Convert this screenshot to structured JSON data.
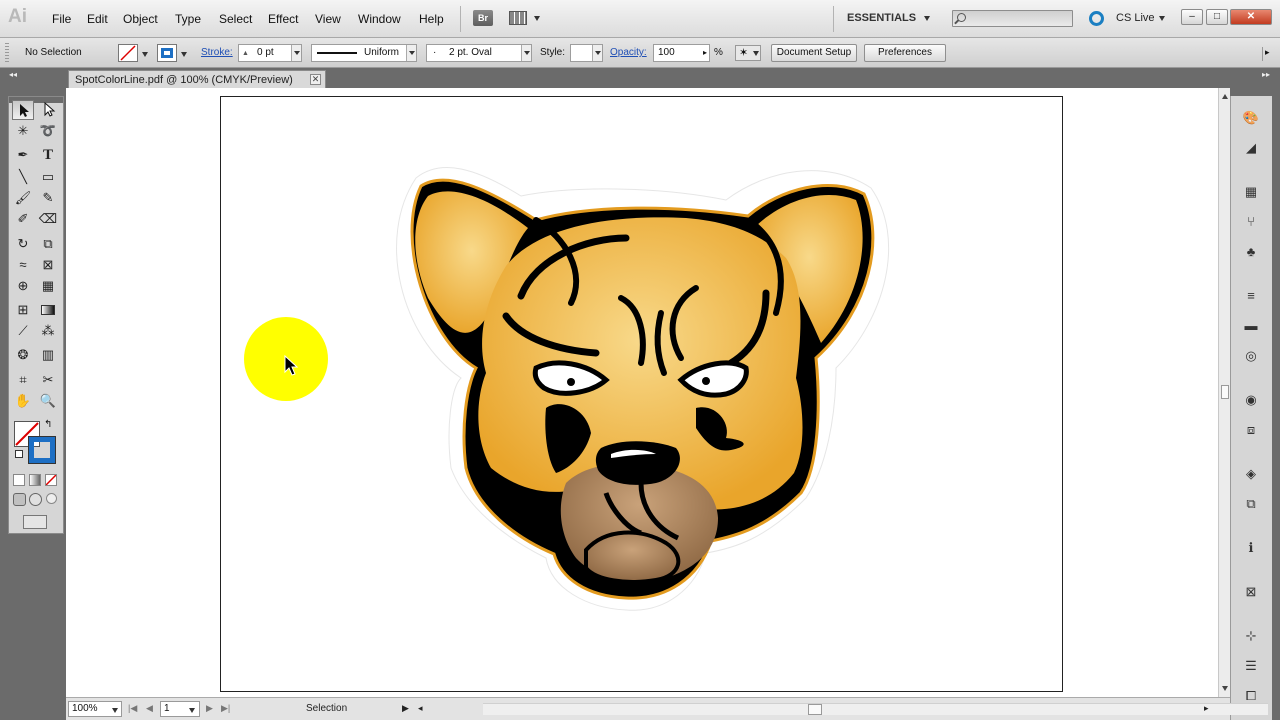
{
  "app": {
    "logo": "Ai",
    "bridge_label": "Br"
  },
  "menu": [
    "File",
    "Edit",
    "Object",
    "Type",
    "Select",
    "Effect",
    "View",
    "Window",
    "Help"
  ],
  "workspace": "ESSENTIALS",
  "search_placeholder": "",
  "cs_live": "CS Live",
  "window_controls": {
    "minimize": "–",
    "maximize": "□",
    "close": "✕"
  },
  "control_bar": {
    "selection": "No Selection",
    "stroke_label": "Stroke:",
    "stroke_weight": "0 pt",
    "profile": "Uniform",
    "brush": "2 pt. Oval",
    "brush_dot": "·",
    "style_label": "Style:",
    "opacity_label": "Opacity:",
    "opacity_value": "100",
    "opacity_unit": "%",
    "document_setup": "Document Setup",
    "preferences": "Preferences"
  },
  "document_tab": {
    "title": "SpotColorLine.pdf @ 100% (CMYK/Preview)",
    "close": "✕"
  },
  "status_bar": {
    "zoom": "100%",
    "artboard": "1",
    "current_tool": "Selection",
    "nav_first": "|◀",
    "nav_prev": "◀",
    "nav_next": "▶",
    "nav_last": "▶|"
  },
  "colors": {
    "highlight": "#ffff00",
    "fur_light": "#f8d98a",
    "fur_dark": "#e9a52b",
    "muzzle_light": "#c9a27a",
    "muzzle_dark": "#8a6440",
    "ink": "#000000",
    "outline_gold": "#e39b1f"
  }
}
